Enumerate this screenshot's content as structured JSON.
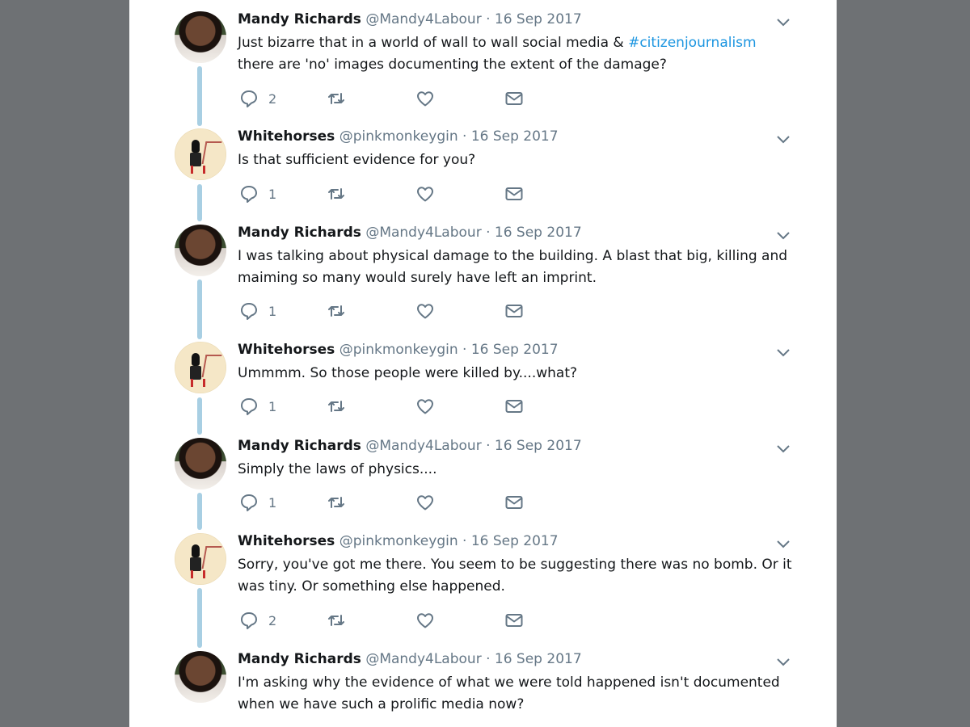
{
  "tweets": [
    {
      "name": "Mandy Richards",
      "handle": "@Mandy4Labour",
      "date": "· 16 Sep 2017",
      "text_pre": "Just bizarre that in a world of wall to wall social media & ",
      "hashtag": "#citizenjournalism",
      "text_post": " there are 'no' images documenting the extent of the damage?",
      "reply_count": "2",
      "avatar": "mandy"
    },
    {
      "name": "Whitehorses",
      "handle": "@pinkmonkeygin",
      "date": "· 16 Sep 2017",
      "text": "Is that sufficient evidence for you?",
      "reply_count": "1",
      "avatar": "whitehorses"
    },
    {
      "name": "Mandy Richards",
      "handle": "@Mandy4Labour",
      "date": "· 16 Sep 2017",
      "text": "I was talking about physical damage to the building. A blast that big, killing and maiming so many would surely have left an imprint.",
      "reply_count": "1",
      "avatar": "mandy"
    },
    {
      "name": "Whitehorses",
      "handle": "@pinkmonkeygin",
      "date": "· 16 Sep 2017",
      "text": "Ummmm. So those people were killed by....what?",
      "reply_count": "1",
      "avatar": "whitehorses"
    },
    {
      "name": "Mandy Richards",
      "handle": "@Mandy4Labour",
      "date": "· 16 Sep 2017",
      "text": "Simply the laws of physics....",
      "reply_count": "1",
      "avatar": "mandy"
    },
    {
      "name": "Whitehorses",
      "handle": "@pinkmonkeygin",
      "date": "· 16 Sep 2017",
      "text": "Sorry, you've got me there. You seem to be suggesting there was no bomb. Or it was tiny. Or something else happened.",
      "reply_count": "2",
      "avatar": "whitehorses"
    },
    {
      "name": "Mandy Richards",
      "handle": "@Mandy4Labour",
      "date": "· 16 Sep 2017",
      "text": "I'm asking why the evidence of what we were told happened isn't documented when we have such a prolific media now?",
      "avatar": "mandy"
    }
  ],
  "icons": {
    "reply": "reply-icon",
    "retweet": "retweet-icon",
    "like": "heart-icon",
    "dm": "envelope-icon",
    "more": "chevron-down-icon"
  },
  "colors": {
    "background": "#6e7174",
    "panel": "#ffffff",
    "thread_line": "#a8cfe3",
    "hashtag": "#1b95e0",
    "meta": "#657786"
  }
}
